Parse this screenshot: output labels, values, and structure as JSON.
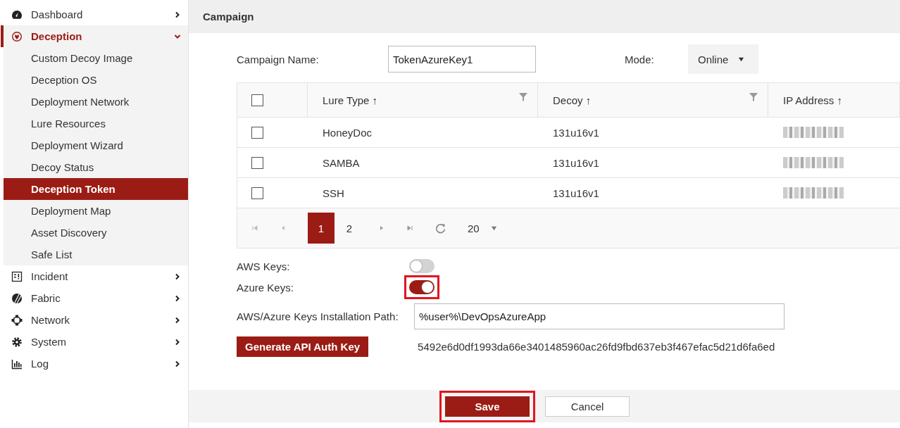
{
  "sidebar": {
    "items": [
      {
        "label": "Dashboard",
        "selected": false,
        "expanded": false
      },
      {
        "label": "Deception",
        "selected": true,
        "expanded": true,
        "children": [
          {
            "label": "Custom Decoy Image",
            "selected": false
          },
          {
            "label": "Deception OS",
            "selected": false
          },
          {
            "label": "Deployment Network",
            "selected": false
          },
          {
            "label": "Lure Resources",
            "selected": false
          },
          {
            "label": "Deployment Wizard",
            "selected": false
          },
          {
            "label": "Decoy Status",
            "selected": false
          },
          {
            "label": "Deception Token",
            "selected": true
          },
          {
            "label": "Deployment Map",
            "selected": false
          },
          {
            "label": "Asset Discovery",
            "selected": false
          },
          {
            "label": "Safe List",
            "selected": false
          }
        ]
      },
      {
        "label": "Incident",
        "selected": false,
        "expanded": false
      },
      {
        "label": "Fabric",
        "selected": false,
        "expanded": false
      },
      {
        "label": "Network",
        "selected": false,
        "expanded": false
      },
      {
        "label": "System",
        "selected": false,
        "expanded": false
      },
      {
        "label": "Log",
        "selected": false,
        "expanded": false
      }
    ]
  },
  "header": {
    "title": "Campaign"
  },
  "form": {
    "campaign_name_label": "Campaign Name:",
    "campaign_name": "TokenAzureKey1",
    "mode_label": "Mode:",
    "mode": "Online"
  },
  "table": {
    "all_checked": false,
    "columns": [
      {
        "label": "Lure Type ↑",
        "filter": true
      },
      {
        "label": "Decoy ↑",
        "filter": true
      },
      {
        "label": "IP Address ↑",
        "filter": false
      }
    ],
    "rows": [
      {
        "checked": false,
        "cells": [
          "HoneyDoc",
          "131u16v1"
        ]
      },
      {
        "checked": false,
        "cells": [
          "SAMBA",
          "131u16v1"
        ]
      },
      {
        "checked": false,
        "cells": [
          "SSH",
          "131u16v1"
        ]
      }
    ],
    "pager": {
      "pages": [
        {
          "label": "1",
          "selected": true
        },
        {
          "label": "2",
          "selected": false
        }
      ],
      "page_size": "20"
    }
  },
  "toggles": [
    {
      "label": "AWS Keys:",
      "on": false,
      "highlighted": false
    },
    {
      "label": "Azure Keys:",
      "on": true,
      "highlighted": true
    }
  ],
  "path": {
    "label": "AWS/Azure Keys Installation Path:",
    "value": "%user%\\DevOpsAzureApp"
  },
  "api_key": {
    "button": "Generate API Auth Key",
    "value": "5492e6d0df1993da66e3401485960ac26fd9fbd637eb3f467efac5d21d6fa6ed"
  },
  "footer": {
    "buttons": [
      {
        "label": "Save",
        "kind": "primary",
        "highlighted": true
      },
      {
        "label": "Cancel",
        "kind": "secondary",
        "highlighted": false
      }
    ]
  }
}
